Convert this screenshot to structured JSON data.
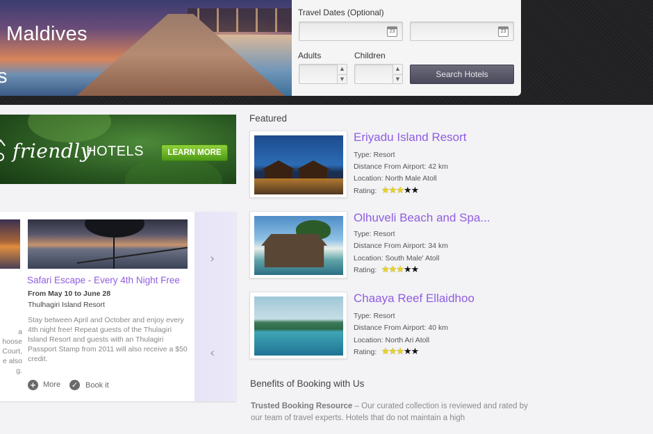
{
  "hero": {
    "title": "Maldives",
    "subtitle_fragment": "s"
  },
  "search": {
    "travel_dates_label": "Travel Dates (Optional)",
    "checkin_value": "",
    "checkout_value": "",
    "calendar_icon_text": "23",
    "adults_label": "Adults",
    "adults_value": "",
    "children_label": "Children",
    "children_value": "",
    "search_button_label": "Search Hotels"
  },
  "banner": {
    "friendly_text": "friendly",
    "hotels_text": "HOTELS",
    "learn_more_label": "LEARN MORE"
  },
  "carousel": {
    "title": "Safari Escape - Every 4th Night Free",
    "dates": "From May 10 to June 28",
    "location": "Thulhagiri Island Resort",
    "description": "Stay between April and October and enjoy every 4th night free! Repeat guests of the Thulagiri Island Resort and guests with an Thulagiri Passport Stamp from 2011 will also receive a $50 credit.",
    "prev_card_fragments": [
      "a",
      "hoose",
      "Court,",
      "e also",
      "g."
    ],
    "more_label": "More",
    "book_label": "Book it"
  },
  "featured": {
    "heading": "Featured",
    "hotels": [
      {
        "name": "Eriyadu Island Resort",
        "type": "Type: Resort",
        "distance": "Distance From Airport: 42 km",
        "location": "Location: North Male Atoll",
        "rating_label": "Rating:",
        "rating": 3.5
      },
      {
        "name": "Olhuveli Beach and Spa...",
        "type": "Type: Resort",
        "distance": "Distance From Airport: 34 km",
        "location": "Location: South Male' Atoll",
        "rating_label": "Rating:",
        "rating": 3.5
      },
      {
        "name": "Chaaya Reef Ellaidhoo",
        "type": "Type: Resort",
        "distance": "Distance From Airport: 40 km",
        "location": "Location: North Ari Atoll",
        "rating_label": "Rating:",
        "rating": 3.5
      }
    ]
  },
  "benefits": {
    "heading": "Benefits of Booking with Us",
    "lead": "Trusted Booking Resource",
    "text": " – Our curated collection is reviewed and rated by our team of travel experts. Hotels that do not maintain a high"
  },
  "colors": {
    "accent_purple": "#8f5ee0",
    "search_button": "#4b4a5c",
    "learn_more_green": "#6cb327",
    "star_yellow": "#e8d226"
  }
}
